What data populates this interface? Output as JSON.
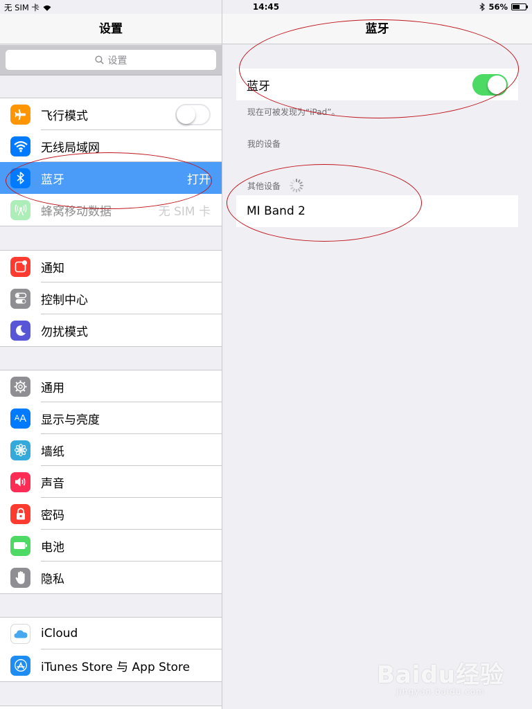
{
  "status_bar": {
    "carrier": "无 SIM 卡",
    "time": "14:45",
    "battery_percent": "56%",
    "battery_level": 0.56
  },
  "master": {
    "title": "设置",
    "search_placeholder": "设置",
    "group1": [
      {
        "label": "飞行模式",
        "icon": "airplane-icon",
        "color": "#ff9500",
        "toggle": false
      },
      {
        "label": "无线局域网",
        "icon": "wifi-icon",
        "color": "#007aff"
      },
      {
        "label": "蓝牙",
        "icon": "bluetooth-icon",
        "color": "#007aff",
        "value": "打开",
        "selected": true
      },
      {
        "label": "蜂窝移动数据",
        "icon": "cellular-icon",
        "color": "#4cd964",
        "value": "无 SIM 卡",
        "disabled": true
      }
    ],
    "group2": [
      {
        "label": "通知",
        "icon": "notifications-icon",
        "color": "#ff3b30"
      },
      {
        "label": "控制中心",
        "icon": "control-center-icon",
        "color": "#8e8e93"
      },
      {
        "label": "勿扰模式",
        "icon": "moon-icon",
        "color": "#5856d6"
      }
    ],
    "group3": [
      {
        "label": "通用",
        "icon": "gear-icon",
        "color": "#8e8e93"
      },
      {
        "label": "显示与亮度",
        "icon": "display-icon",
        "color": "#007aff"
      },
      {
        "label": "墙纸",
        "icon": "wallpaper-icon",
        "color": "#34aadc"
      },
      {
        "label": "声音",
        "icon": "sound-icon",
        "color": "#ff2d55"
      },
      {
        "label": "密码",
        "icon": "lock-icon",
        "color": "#ff3b30"
      },
      {
        "label": "电池",
        "icon": "battery-icon",
        "color": "#4cd964"
      },
      {
        "label": "隐私",
        "icon": "hand-icon",
        "color": "#8e8e93"
      }
    ],
    "group4": [
      {
        "label": "iCloud",
        "icon": "icloud-icon",
        "color": "#ffffff"
      },
      {
        "label": "iTunes Store 与 App Store",
        "icon": "appstore-icon",
        "color": "#1d8cf3"
      }
    ]
  },
  "detail": {
    "title": "蓝牙",
    "bluetooth_label": "蓝牙",
    "bluetooth_on": true,
    "discoverable_text": "现在可被发现为“iPad”。",
    "my_devices_header": "我的设备",
    "other_devices_header": "其他设备",
    "other_devices": [
      "MI Band 2"
    ]
  },
  "watermark": {
    "logo": "Baidu经验",
    "url": "jingyan.baidu.com"
  }
}
